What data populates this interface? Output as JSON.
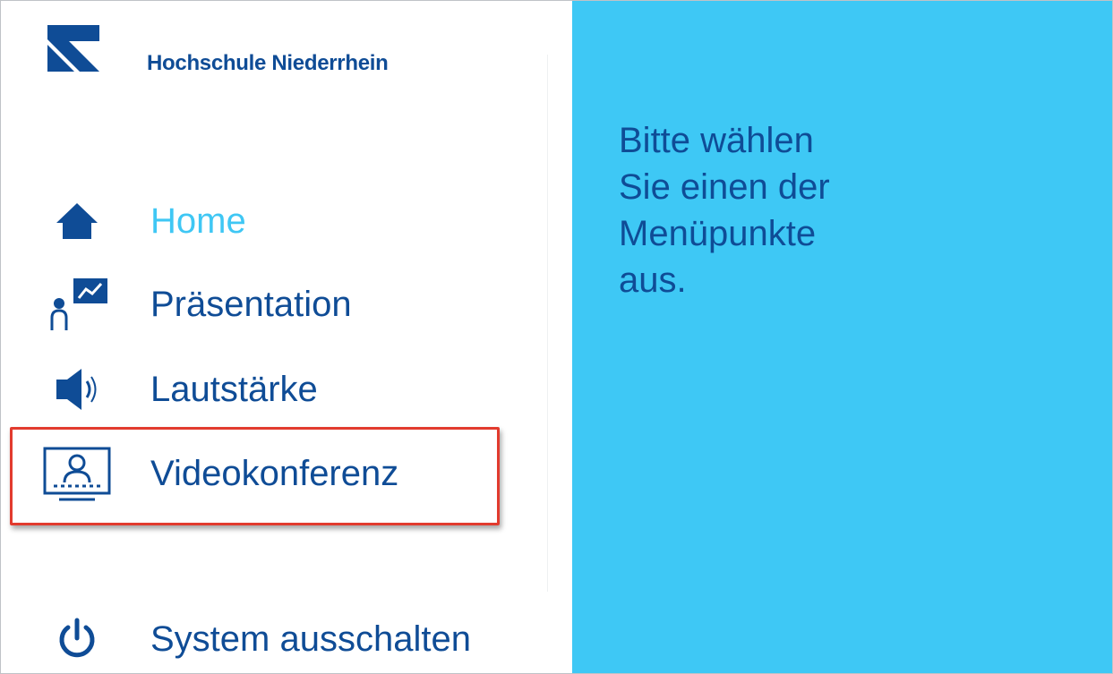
{
  "header": {
    "org_name": "Hochschule Niederrhein",
    "logo_icon": "hsnr-logo-icon"
  },
  "sidebar": {
    "items": [
      {
        "label": "Home",
        "icon": "home-icon",
        "active": true
      },
      {
        "label": "Präsentation",
        "icon": "presentation-icon",
        "active": false
      },
      {
        "label": "Lautstärke",
        "icon": "speaker-icon",
        "active": false
      },
      {
        "label": "Videokonferenz",
        "icon": "video-conference-icon",
        "active": false,
        "highlighted": true
      },
      {
        "label": "System ausschalten",
        "icon": "power-icon",
        "active": false
      }
    ]
  },
  "main": {
    "message_lines": [
      "Bitte wählen",
      "Sie einen der",
      "Menüpunkte",
      "aus."
    ]
  },
  "colors": {
    "navy": "#0f4c96",
    "accent_cyan": "#3ec8f5",
    "active_text": "#3fc7f4",
    "highlight_red": "#e23b2e"
  }
}
